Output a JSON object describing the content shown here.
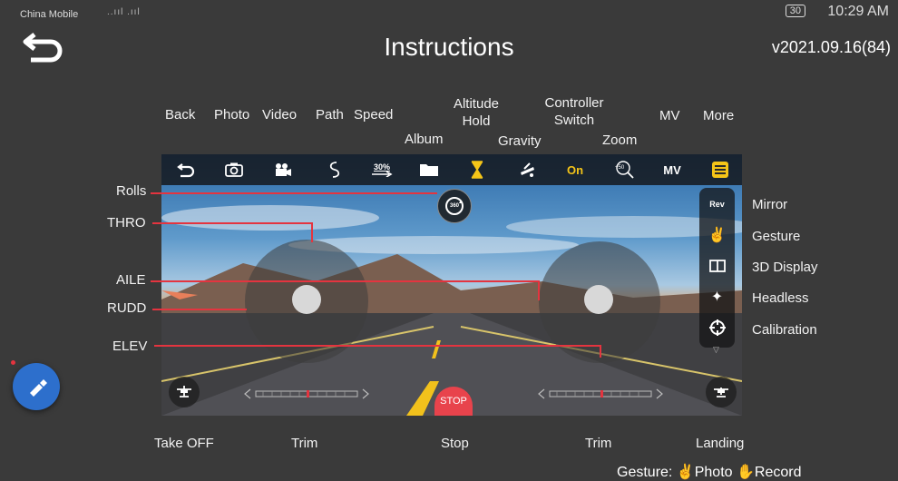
{
  "status_bar": {
    "carrier": "China Mobile",
    "signal": "..ııl  .ııl",
    "battery": "30",
    "time": "10:29 AM"
  },
  "header": {
    "title": "Instructions",
    "version": "v2021.09.16(84)"
  },
  "toolbar_labels": {
    "back": "Back",
    "photo": "Photo",
    "video": "Video",
    "path": "Path",
    "speed": "Speed",
    "album": "Album",
    "altitude_hold": "Altitude Hold",
    "gravity": "Gravity",
    "controller_switch": "Controller Switch",
    "zoom": "Zoom",
    "mv": "MV",
    "more": "More"
  },
  "toolbar": {
    "speed_value": "30%",
    "switch_value": "On",
    "zoom_value": "+50",
    "mv_value": "MV"
  },
  "left_labels": {
    "rolls": "Rolls",
    "thro": "THRO",
    "aile": "AILE",
    "rudd": "RUDD",
    "elev": "ELEV"
  },
  "right_labels": {
    "mirror": "Mirror",
    "gesture": "Gesture",
    "display_3d": "3D Display",
    "headless": "Headless",
    "calibration": "Calibration"
  },
  "side_panel": {
    "rev": "Rev"
  },
  "rolls_badge": "360",
  "bottom_labels": {
    "take_off": "Take OFF",
    "trim_left": "Trim",
    "stop": "Stop",
    "trim_right": "Trim",
    "landing": "Landing"
  },
  "stop_button": "STOP",
  "footer": {
    "prefix": "Gesture:",
    "photo": "Photo",
    "record": "Record"
  },
  "colors": {
    "accent_red": "#e4343f",
    "highlight_yellow": "#f5c518",
    "fab_blue": "#2d6fcc"
  }
}
